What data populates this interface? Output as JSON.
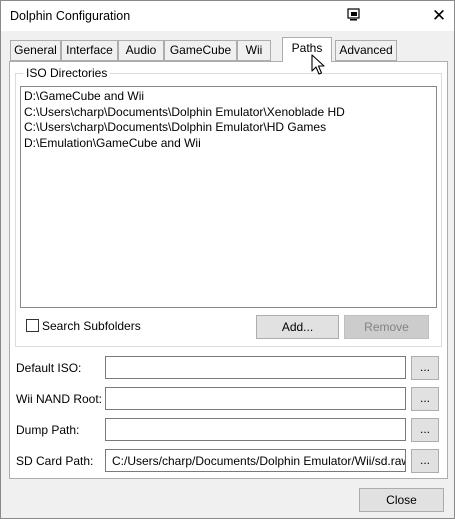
{
  "window": {
    "title": "Dolphin Configuration"
  },
  "tabs": [
    {
      "label": "General"
    },
    {
      "label": "Interface"
    },
    {
      "label": "Audio"
    },
    {
      "label": "GameCube"
    },
    {
      "label": "Wii"
    },
    {
      "label": "Paths",
      "active": true
    },
    {
      "label": "Advanced"
    }
  ],
  "iso": {
    "group_title": "ISO Directories",
    "directories": [
      "D:\\GameCube and Wii",
      "C:\\Users\\charp\\Documents\\Dolphin Emulator\\Xenoblade HD",
      "C:\\Users\\charp\\Documents\\Dolphin Emulator\\HD Games",
      "D:\\Emulation\\GameCube and Wii"
    ],
    "search_subfolders_label": "Search Subfolders",
    "search_subfolders_checked": false,
    "add_label": "Add...",
    "remove_label": "Remove"
  },
  "paths": {
    "default_iso": {
      "label": "Default ISO:",
      "value": ""
    },
    "wii_nand_root": {
      "label": "Wii NAND Root:",
      "value": ""
    },
    "dump_path": {
      "label": "Dump Path:",
      "value": ""
    },
    "sd_card_path": {
      "label": "SD Card Path:",
      "value": "C:/Users/charp/Documents/Dolphin Emulator/Wii/sd.raw"
    },
    "browse_label": "..."
  },
  "footer": {
    "close_label": "Close"
  },
  "icons": {
    "window_icon": "screen-icon",
    "close": "close-icon",
    "cursor": "mouse-pointer-icon"
  }
}
